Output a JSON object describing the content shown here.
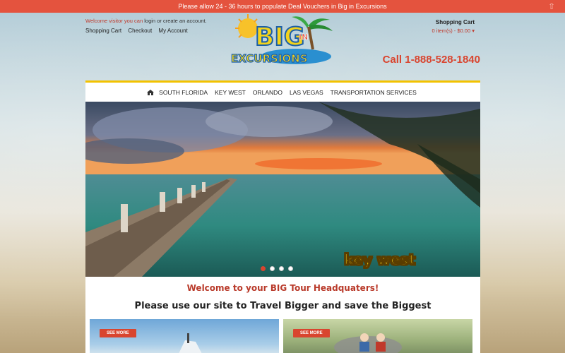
{
  "notice": {
    "text": "Please allow 24 - 36 hours to populate Deal Vouchers in Big in Excursions"
  },
  "header": {
    "welcome_prefix": "Welcome visitor you can",
    "login": "login",
    "or": "or",
    "create_account": "create an account.",
    "links": [
      "Shopping Cart",
      "Checkout",
      "My Account"
    ],
    "cart_title": "Shopping Cart",
    "cart_summary": "0 item(s) - $0.00",
    "phone": "Call 1-888-528-1840",
    "logo_word1": "BIG",
    "logo_word2": "IN",
    "logo_word3": "EXCURSIONS"
  },
  "nav": {
    "items": [
      "SOUTH FLORIDA",
      "KEY WEST",
      "ORLANDO",
      "LAS VEGAS",
      "TRANSPORTATION SERVICES"
    ]
  },
  "slider": {
    "caption": "key west",
    "slides": 4,
    "active": 1
  },
  "content": {
    "welcome": "Welcome to your BIG Tour Headquaters!",
    "tagline": "Please use our site to Travel Bigger and save the Biggest",
    "see_more_left": "SEE MORE",
    "see_more_right": "SEE MORE"
  },
  "colors": {
    "accent": "#d9452f",
    "nav_border": "#f2c200",
    "notice_bg": "#e4533e"
  }
}
